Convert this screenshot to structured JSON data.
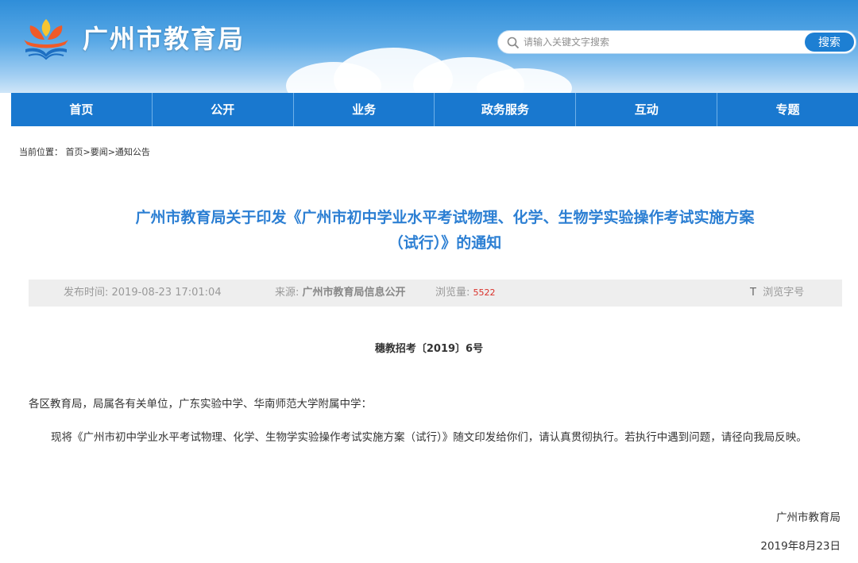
{
  "site": {
    "title": "广州市教育局"
  },
  "search": {
    "placeholder": "请输入关键文字搜索",
    "button_label": "搜索"
  },
  "nav": {
    "items": [
      "首页",
      "公开",
      "业务",
      "政务服务",
      "互动",
      "专题"
    ]
  },
  "breadcrumb": {
    "label": "当前位置：",
    "path": "首页>要闻>通知公告"
  },
  "article": {
    "title_line1": "广州市教育局关于印发《广州市初中学业水平考试物理、化学、生物学实验操作考试实施方案",
    "title_line2": "（试行）》的通知",
    "meta": {
      "publish_label": "发布时间: ",
      "publish_time": "2019-08-23 17:01:04",
      "source_label": "来源: ",
      "source": "广州市教育局信息公开",
      "views_label": "浏览量: ",
      "views": "5522",
      "font_icon": "T",
      "font_label": "浏览字号"
    },
    "doc_number": "穗教招考〔2019〕6号",
    "salutation": "各区教育局，局属各有关单位，广东实验中学、华南师范大学附属中学：",
    "body": "现将《广州市初中学业水平考试物理、化学、生物学实验操作考试实施方案（试行）》随文印发给你们，请认真贯彻执行。若执行中遇到问题，请径向我局反映。",
    "signature_org": "广州市教育局",
    "signature_date": "2019年8月23日"
  },
  "colors": {
    "nav_bg": "#1978cf",
    "title_blue": "#2c7fd3",
    "views_red": "#d9302a"
  },
  "icons": {
    "logo": "education-bureau-emblem",
    "search": "search-icon"
  }
}
